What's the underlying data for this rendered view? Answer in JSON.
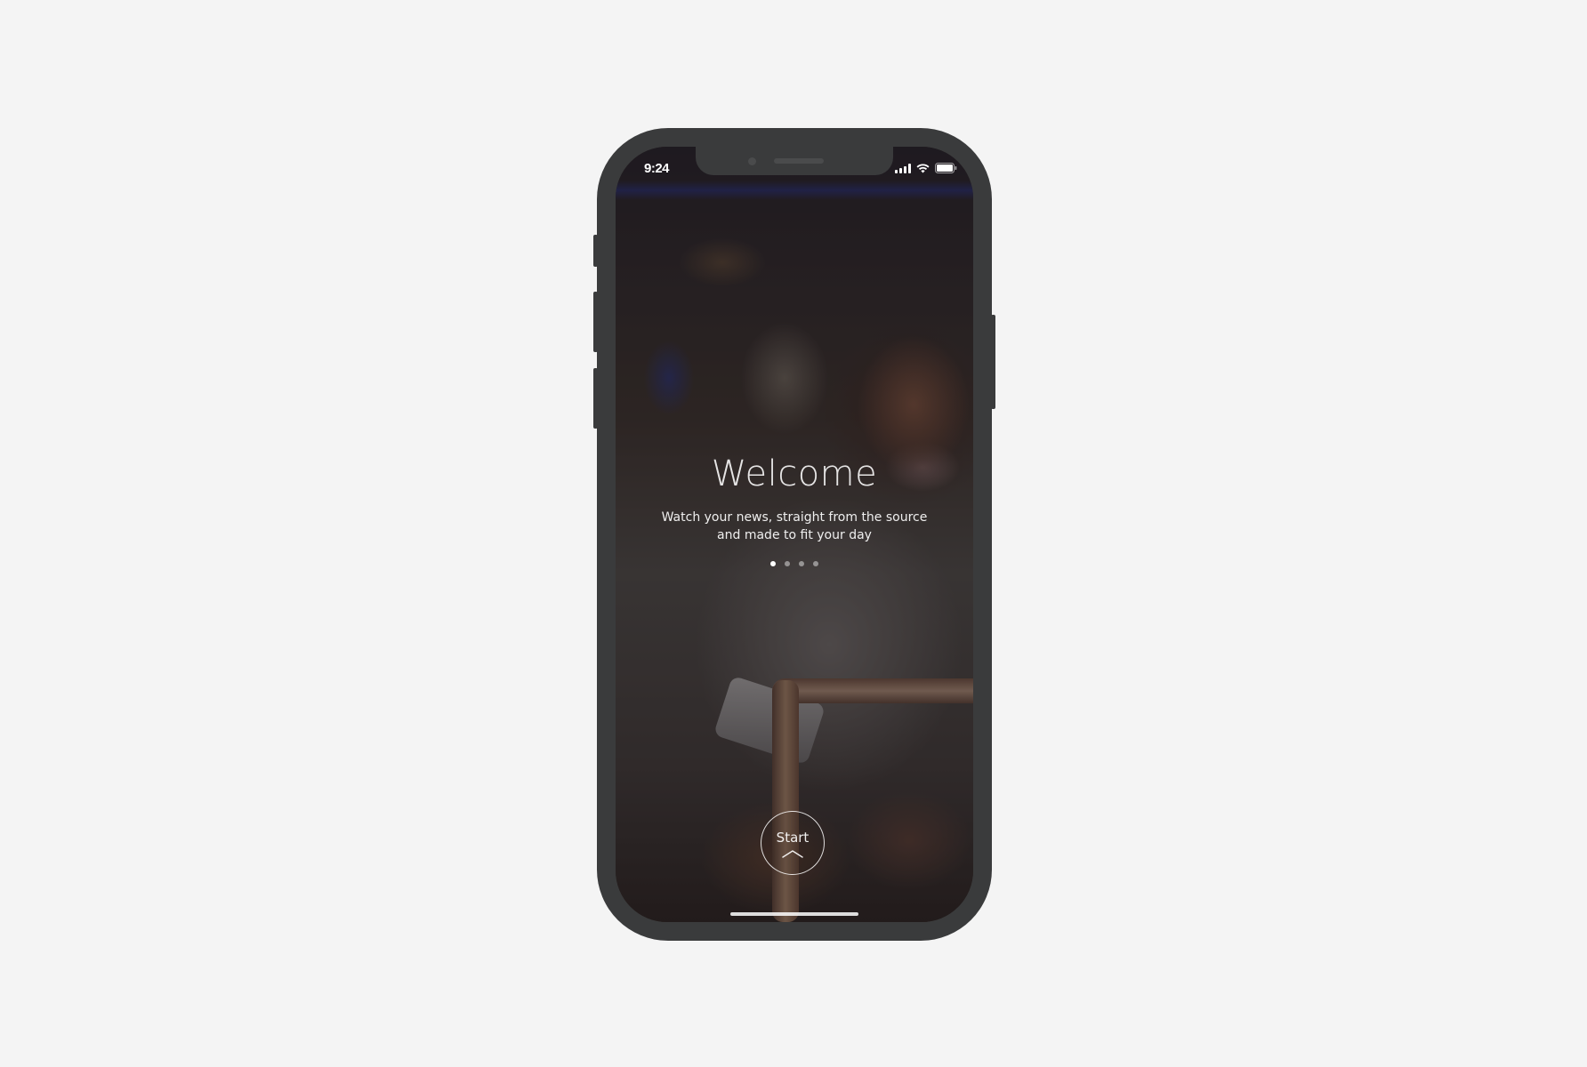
{
  "status_bar": {
    "time": "9:24",
    "icons": [
      "signal-icon",
      "wifi-icon",
      "battery-icon"
    ]
  },
  "onboarding": {
    "title": "Welcome",
    "subtitle_line1": "Watch your news, straight from the source",
    "subtitle_line2": "and made to fit your day",
    "pagination": {
      "total": 4,
      "current": 1
    },
    "start_button": {
      "label": "Start",
      "icon": "chevron-up-icon"
    }
  },
  "colors": {
    "page_background": "#f4f4f4",
    "device_frame": "#3a3b3c",
    "text": "#ffffff"
  }
}
